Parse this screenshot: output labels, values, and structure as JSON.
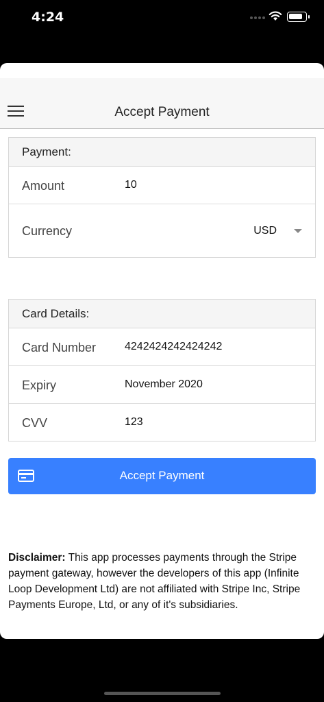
{
  "status_bar": {
    "time": "4:24"
  },
  "nav": {
    "title": "Accept Payment"
  },
  "payment": {
    "header": "Payment:",
    "amount_label": "Amount",
    "amount_value": "10",
    "currency_label": "Currency",
    "currency_value": "USD"
  },
  "card_details": {
    "header": "Card Details:",
    "card_number_label": "Card Number",
    "card_number_value": "4242424242424242",
    "expiry_label": "Expiry",
    "expiry_value": "November 2020",
    "cvv_label": "CVV",
    "cvv_value": "123"
  },
  "accept_button": {
    "label": "Accept Payment",
    "icon": "credit-card-icon",
    "color": "#3880ff"
  },
  "disclaimer": {
    "title": "Disclaimer:",
    "text": "This app processes payments through the Stripe payment gateway, however the developers of this app (Infinite Loop Development Ltd) are not affiliated with Stripe Inc, Stripe Payments Europe, Ltd, or any of it's subsidiaries."
  }
}
